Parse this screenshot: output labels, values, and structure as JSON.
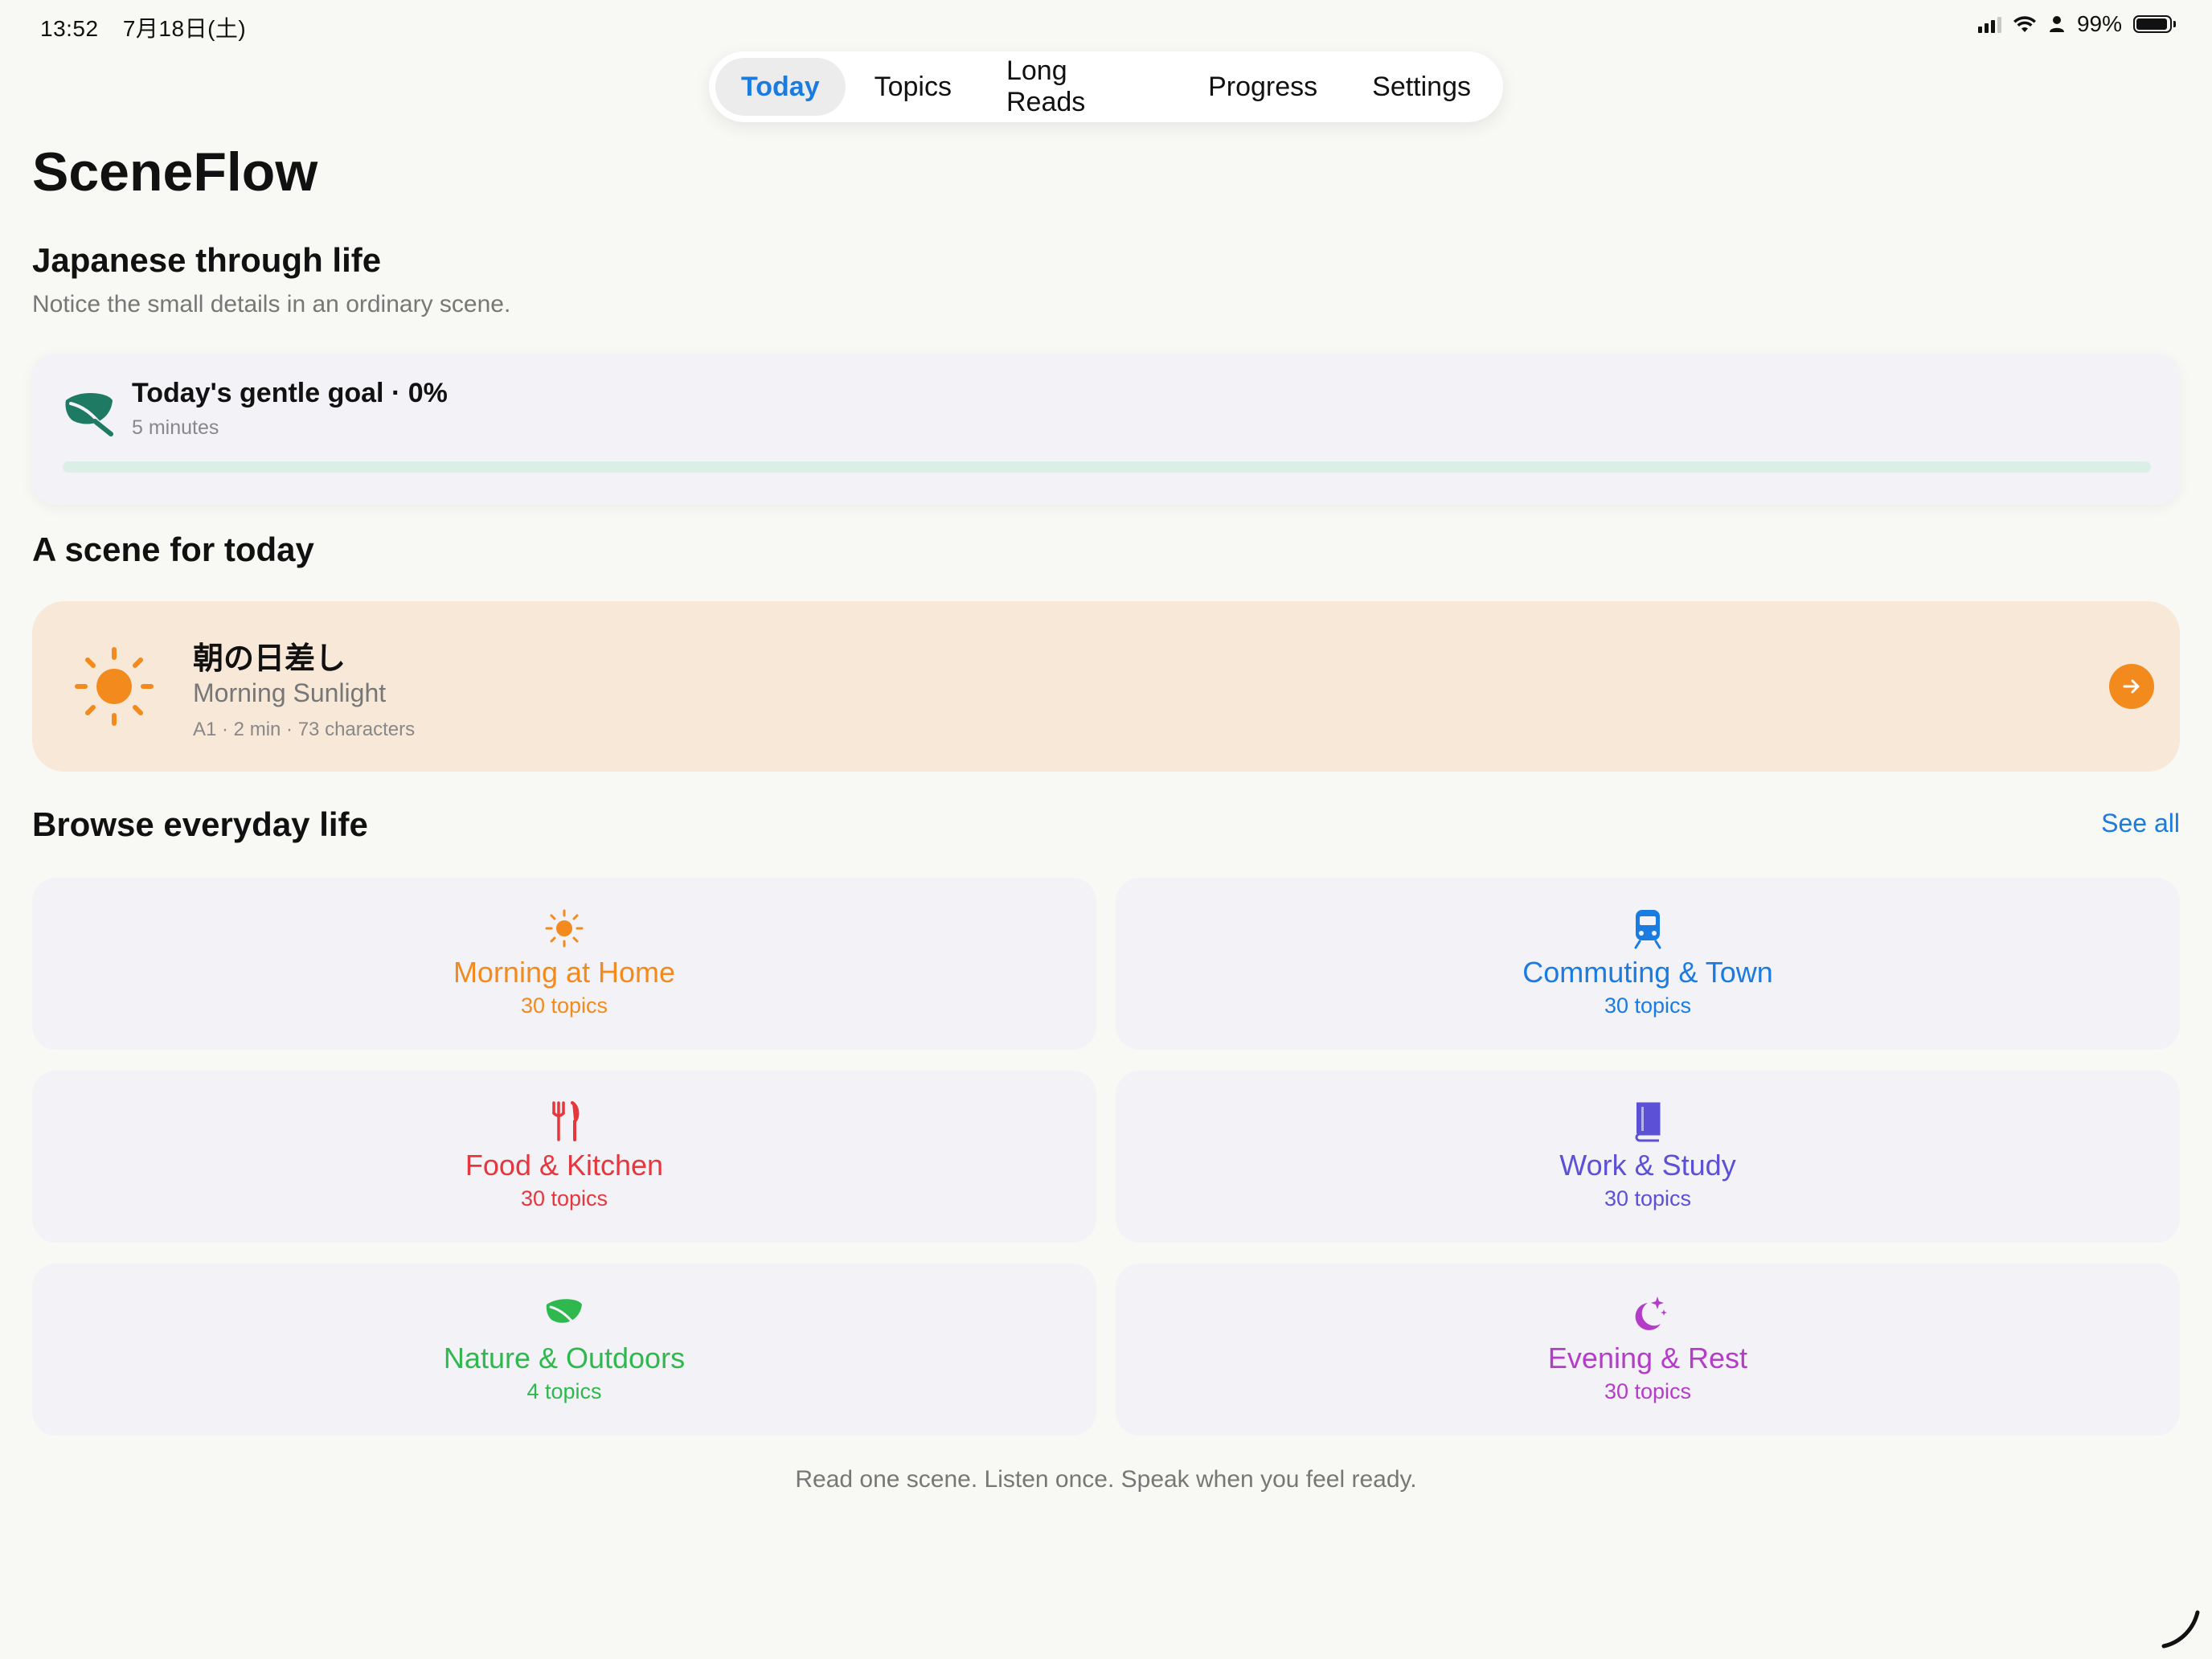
{
  "status_bar": {
    "time": "13:52",
    "date": "7月18日(土)",
    "battery": "99%"
  },
  "tabs": [
    {
      "label": "Today",
      "active": true
    },
    {
      "label": "Topics",
      "active": false
    },
    {
      "label": "Long Reads",
      "active": false
    },
    {
      "label": "Progress",
      "active": false
    },
    {
      "label": "Settings",
      "active": false
    }
  ],
  "header": {
    "app_title": "SceneFlow",
    "section_title": "Japanese through life",
    "subtitle": "Notice the small details in an ordinary scene."
  },
  "goal": {
    "title": "Today's gentle goal · 0%",
    "subtitle": "5 minutes",
    "progress": 0,
    "icon": "leaf-icon"
  },
  "scene": {
    "section_title": "A scene for today",
    "title_jp": "朝の日差し",
    "title_en": "Morning Sunlight",
    "meta": "A1 · 2 min · 73 characters",
    "icon": "sun-icon"
  },
  "browse": {
    "section_title": "Browse everyday life",
    "see_all": "See all",
    "categories": [
      {
        "name": "Morning at Home",
        "count": "30 topics",
        "color": "#f28a1e",
        "icon": "sun-icon"
      },
      {
        "name": "Commuting & Town",
        "count": "30 topics",
        "color": "#1a7be0",
        "icon": "train-icon"
      },
      {
        "name": "Food & Kitchen",
        "count": "30 topics",
        "color": "#e5373d",
        "icon": "fork-knife-icon"
      },
      {
        "name": "Work & Study",
        "count": "30 topics",
        "color": "#5b50d6",
        "icon": "book-icon"
      },
      {
        "name": "Nature & Outdoors",
        "count": "4 topics",
        "color": "#2fb84e",
        "icon": "leaf-icon"
      },
      {
        "name": "Evening & Rest",
        "count": "30 topics",
        "color": "#b43cc9",
        "icon": "moon-stars-icon"
      }
    ]
  },
  "footer": "Read one scene. Listen once. Speak when you feel ready.",
  "colors": {
    "accent": "#1a7be0",
    "scene_bg": "#f8e8d8",
    "scene_accent": "#f28a1e",
    "goal_leaf": "#1f7a63"
  }
}
